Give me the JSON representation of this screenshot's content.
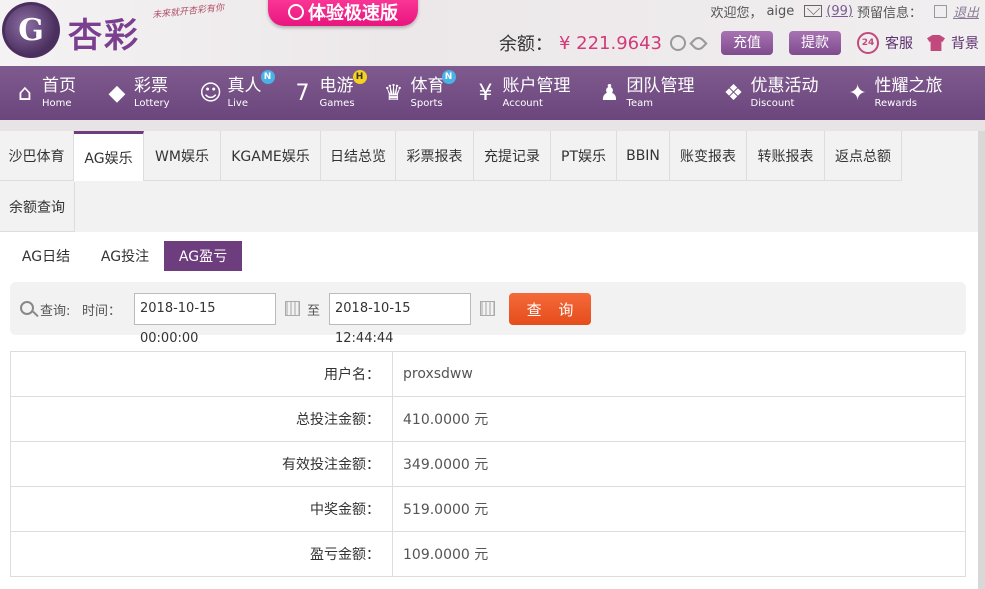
{
  "header": {
    "logo_glyph": "G",
    "logo_text": "杏彩",
    "slogan": "未来就开杏彩有你",
    "promo": "体验极速版",
    "welcome": "欢迎您，",
    "username": "aige",
    "msg_count": "(99)",
    "reserve_info": "预留信息：",
    "logout": "退出",
    "balance_label": "余额：",
    "balance_value": "¥ 221.9643",
    "deposit": "充值",
    "withdraw": "提款",
    "support_badge": "24",
    "support": "客服",
    "background": "背景"
  },
  "nav": [
    {
      "cn": "首页",
      "en": "Home",
      "icon": "home-icon",
      "glyph": "⌂",
      "badge": ""
    },
    {
      "cn": "彩票",
      "en": "Lottery",
      "icon": "lottery-icon",
      "glyph": "◆",
      "badge": ""
    },
    {
      "cn": "真人",
      "en": "Live",
      "icon": "live-dealer-icon",
      "glyph": "☺",
      "badge": "N"
    },
    {
      "cn": "电游",
      "en": "Games",
      "icon": "slot-game-icon",
      "glyph": "7",
      "badge": "H"
    },
    {
      "cn": "体育",
      "en": "Sports",
      "icon": "trophy-icon",
      "glyph": "♛",
      "badge": "N"
    },
    {
      "cn": "账户管理",
      "en": "Account",
      "icon": "yen-coin-icon",
      "glyph": "¥",
      "badge": ""
    },
    {
      "cn": "团队管理",
      "en": "Team",
      "icon": "team-icon",
      "glyph": "♟",
      "badge": ""
    },
    {
      "cn": "优惠活动",
      "en": "Discount",
      "icon": "gift-icon",
      "glyph": "❖",
      "badge": ""
    },
    {
      "cn": "性耀之旅",
      "en": "Rewards",
      "icon": "rewards-icon",
      "glyph": "✦",
      "badge": ""
    }
  ],
  "tabs": [
    "沙巴体育",
    "AG娱乐",
    "WM娱乐",
    "KGAME娱乐",
    "日结总览",
    "彩票报表",
    "充提记录",
    "PT娱乐",
    "BBIN",
    "账变报表",
    "转账报表",
    "返点总额",
    "余额查询"
  ],
  "subtabs": [
    "AG日结",
    "AG投注",
    "AG盈亏"
  ],
  "query": {
    "label": "查询:",
    "time_label": "时间：",
    "start": "2018-10-15 00:00:00",
    "to": "至",
    "end": "2018-10-15 12:44:44",
    "button": "查 询"
  },
  "results": [
    {
      "label": "用户名：",
      "value": "proxsdww"
    },
    {
      "label": "总投注金额：",
      "value": "410.0000 元"
    },
    {
      "label": "有效投注金额：",
      "value": "349.0000 元"
    },
    {
      "label": "中奖金额：",
      "value": "519.0000 元"
    },
    {
      "label": "盈亏金额：",
      "value": "109.0000 元"
    }
  ]
}
